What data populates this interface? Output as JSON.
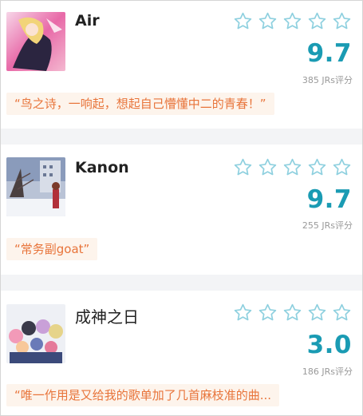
{
  "colors": {
    "accent": "#1a9bb3",
    "quote_text": "#e8743a",
    "quote_bg": "#fdf4ec",
    "star_outline": "#8ed0df"
  },
  "items": [
    {
      "title": "Air",
      "rating_stars": 5,
      "filled_stars": 0,
      "score": "9.7",
      "count": "385 JRs评分",
      "quote": "“鸟之诗，一响起，想起自己懵懂中二的青春！”",
      "thumb_icon": "anime-cover-air"
    },
    {
      "title": "Kanon",
      "rating_stars": 5,
      "filled_stars": 0,
      "score": "9.7",
      "count": "255 JRs评分",
      "quote": "“常务副goat”",
      "thumb_icon": "anime-cover-kanon"
    },
    {
      "title": "成神之日",
      "rating_stars": 5,
      "filled_stars": 0,
      "score": "3.0",
      "count": "186 JRs评分",
      "quote": "“唯一作用是又给我的歌单加了几首麻枝准的曲...",
      "thumb_icon": "anime-cover-kamisama-ni-natta-hi"
    }
  ]
}
